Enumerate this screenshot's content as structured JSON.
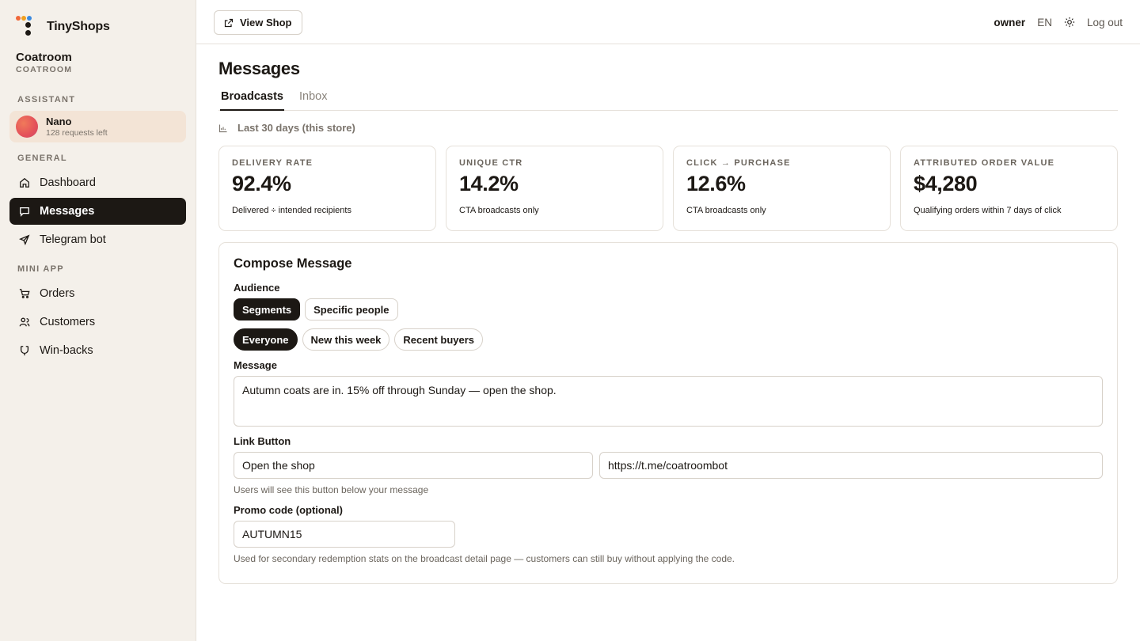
{
  "brand": {
    "name": "TinyShops",
    "logo_colors": [
      "#f0683a",
      "#f0a020",
      "#3a8ae0",
      "#1c1814"
    ]
  },
  "store": {
    "name": "Coatroom",
    "subtitle": "COATROOM"
  },
  "sidebar": {
    "assistant_label": "ASSISTANT",
    "assistant": {
      "name": "Nano",
      "requests": "128 requests left"
    },
    "general_label": "GENERAL",
    "mini_app_label": "MINI APP",
    "items": [
      {
        "label": "Dashboard",
        "icon": "home-icon"
      },
      {
        "label": "Messages",
        "icon": "message-icon",
        "active": true
      },
      {
        "label": "Telegram bot",
        "icon": "send-icon"
      },
      {
        "label": "Orders",
        "icon": "cart-icon"
      },
      {
        "label": "Customers",
        "icon": "users-icon"
      },
      {
        "label": "Win-backs",
        "icon": "magnet-icon"
      }
    ]
  },
  "topbar": {
    "view_shop": "View Shop",
    "user": "owner",
    "language": "EN",
    "theme_icon": "sun-icon",
    "logout": "Log out"
  },
  "page": {
    "title": "Messages",
    "tabs": [
      {
        "label": "Broadcasts",
        "active": true
      },
      {
        "label": "Inbox",
        "active": false
      }
    ],
    "range": "Last 30 days (this store)"
  },
  "stats": [
    {
      "label": "DELIVERY RATE",
      "value": "92.4%",
      "note": "Delivered ÷ intended recipients"
    },
    {
      "label": "UNIQUE CTR",
      "value": "14.2%",
      "note": "CTA broadcasts only"
    },
    {
      "label": "CLICK → PURCHASE",
      "value": "12.6%",
      "note": "CTA broadcasts only"
    },
    {
      "label": "ATTRIBUTED ORDER VALUE",
      "value": "$4,280",
      "note": "Qualifying orders within 7 days of click"
    }
  ],
  "compose": {
    "title": "Compose Message",
    "audience_label": "Audience",
    "audience_modes": [
      {
        "label": "Segments",
        "selected": true
      },
      {
        "label": "Specific people",
        "selected": false
      }
    ],
    "segments": [
      {
        "label": "Everyone",
        "selected": true
      },
      {
        "label": "New this week",
        "selected": false
      },
      {
        "label": "Recent buyers",
        "selected": false
      }
    ],
    "message_label": "Message",
    "message_value": "Autumn coats are in. 15% off through Sunday — open the shop.",
    "link_label": "Link Button",
    "link_text_value": "Open the shop",
    "link_url_value": "https://t.me/coatroombot",
    "link_hint": "Users will see this button below your message",
    "promo_label": "Promo code (optional)",
    "promo_value": "AUTUMN15",
    "promo_hint": "Used for secondary redemption stats on the broadcast detail page — customers can still buy without applying the code."
  }
}
